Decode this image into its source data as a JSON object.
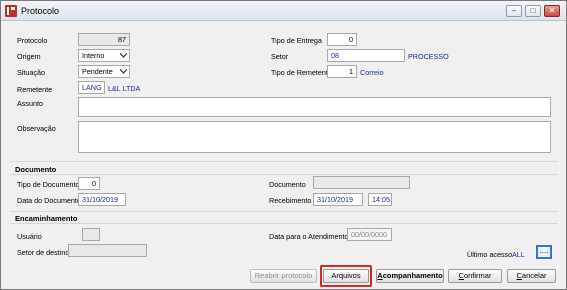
{
  "window": {
    "title": "Protocolo"
  },
  "controls": {
    "minimize": "–",
    "maximize": "□",
    "close": "✕"
  },
  "form": {
    "protocolo": {
      "label": "Protocolo",
      "value": "87"
    },
    "origem": {
      "label": "Origem",
      "value": "Interno"
    },
    "situacao": {
      "label": "Situação",
      "value": "Pendente"
    },
    "remetente": {
      "label": "Remetente",
      "code": "LANG",
      "name": "L&L LTDA"
    },
    "assunto": {
      "label": "Assunto",
      "value": ""
    },
    "observacao": {
      "label": "Observação",
      "value": ""
    },
    "tipo_entrega": {
      "label": "Tipo de Entrega",
      "value": "0"
    },
    "setor": {
      "label": "Setor",
      "code": "08",
      "name": "PROCESSO"
    },
    "tipo_remetente": {
      "label": "Tipo de Remetente",
      "code": "1",
      "name": "Correio"
    }
  },
  "documento": {
    "title": "Documento",
    "tipo_documento": {
      "label": "Tipo de Documento",
      "value": "0"
    },
    "data_documento": {
      "label": "Data do Documento",
      "value": "31/10/2019"
    },
    "documento": {
      "label": "Documento",
      "value": ""
    },
    "recebimento": {
      "label": "Recebimento",
      "date": "31/10/2019",
      "time": "14:05"
    }
  },
  "encaminhamento": {
    "title": "Encaminhamento",
    "usuario": {
      "label": "Usuário",
      "value": ""
    },
    "setor_destino": {
      "label": "Setor de destino",
      "value": ""
    },
    "data_atendimento": {
      "label": "Data para o Atendimento",
      "value": "00/00/0000"
    },
    "ultimo_acesso": {
      "label": "Último acesso",
      "value": "ALL"
    },
    "ellipsis": "...."
  },
  "buttons": {
    "reabrir": "Reabrir protocolo",
    "arquivos": "Arquivos",
    "acompanhamento_first": "A",
    "acompanhamento_rest": "companhamento",
    "confirmar_first": "C",
    "confirmar_rest": "onfirmar",
    "cancelar_first": "C",
    "cancelar_rest": "ancelar"
  },
  "colors": {
    "accent_link": "#1d2a9a",
    "highlight": "#d9262b",
    "title_icon": "#c0302a"
  }
}
